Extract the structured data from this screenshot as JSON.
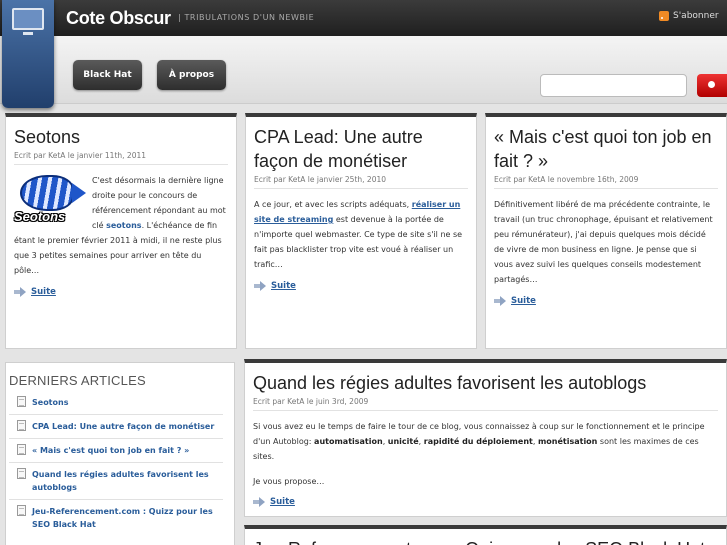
{
  "header": {
    "site_title": "Cote Obscur",
    "tagline": "| TRIBULATIONS D'UN NEWBIE",
    "subscribe_label": "S'abonner",
    "rss_icon": "rss-icon"
  },
  "nav": {
    "items": [
      {
        "label": "Black Hat"
      },
      {
        "label": "À propos"
      }
    ],
    "search_placeholder": ""
  },
  "colors": {
    "accent_link": "#2a5d9a",
    "search_button": "#d10000",
    "header_bg": "#2b2b2b"
  },
  "posts": [
    {
      "title": "Seotons",
      "meta": "Ecrit par KetA le janvier 11th, 2011",
      "image_label": "Seotons",
      "excerpt_pre": "C'est désormais la dernière ligne droite pour le concours de référencement répondant au mot clé ",
      "excerpt_link": "seotons",
      "excerpt_post": ". L'échéance de fin étant le premier février 2011 à midi, il ne reste plus que 3 petites semaines pour arriver en tête du pôle…",
      "more": "Suite"
    },
    {
      "title": "CPA Lead: Une autre façon de monétiser",
      "meta": "Ecrit par KetA le janvier 25th, 2010",
      "excerpt_pre": "A ce jour, et avec les scripts adéquats, ",
      "excerpt_link": "réaliser un site de streaming",
      "excerpt_post": " est devenue à la portée de n'importe quel webmaster. Ce type de site s'il ne se fait pas blacklister trop vite est voué à réaliser un trafic…",
      "more": "Suite"
    },
    {
      "title": "« Mais c'est quoi ton job en fait ? »",
      "meta": "Ecrit par KetA le novembre 16th, 2009",
      "excerpt": "Définitivement libéré de ma précédente contrainte, le travail (un truc chronophage, épuisant et relativement peu rémunérateur), j'ai depuis quelques mois décidé de vivre de mon business en ligne. Je pense que si vous avez suivi les quelques conseils modestement partagés…",
      "more": "Suite"
    },
    {
      "title": "Quand les régies adultes favorisent les autoblogs",
      "meta": "Ecrit par KetA le juin 3rd, 2009",
      "excerpt_pre": "Si vous avez eu le temps de faire le tour de ce blog, vous connaissez à coup sur le fonctionnement et le principe d'un Autoblog: ",
      "bold_1": "automatisation",
      "sep_1": ", ",
      "bold_2": "unicité",
      "sep_2": ", ",
      "bold_3": "rapidité du déploiement",
      "sep_3": ", ",
      "bold_4": "monétisation",
      "excerpt_post": " sont les maximes de ces sites.",
      "excerpt_2": "Je vous propose…",
      "more": "Suite"
    },
    {
      "title": "Jeu-Referencement.com : Quizz pour les SEO Black Hat"
    }
  ],
  "sidebar": {
    "heading": "DERNIERS ARTICLES",
    "items": [
      {
        "label": "Seotons"
      },
      {
        "label": "CPA Lead: Une autre façon de monétiser"
      },
      {
        "label": "« Mais c'est quoi ton job en fait ? »"
      },
      {
        "label": "Quand les régies adultes favorisent les autoblogs"
      },
      {
        "label": "Jeu-Referencement.com : Quizz pour les SEO Black Hat"
      }
    ]
  }
}
